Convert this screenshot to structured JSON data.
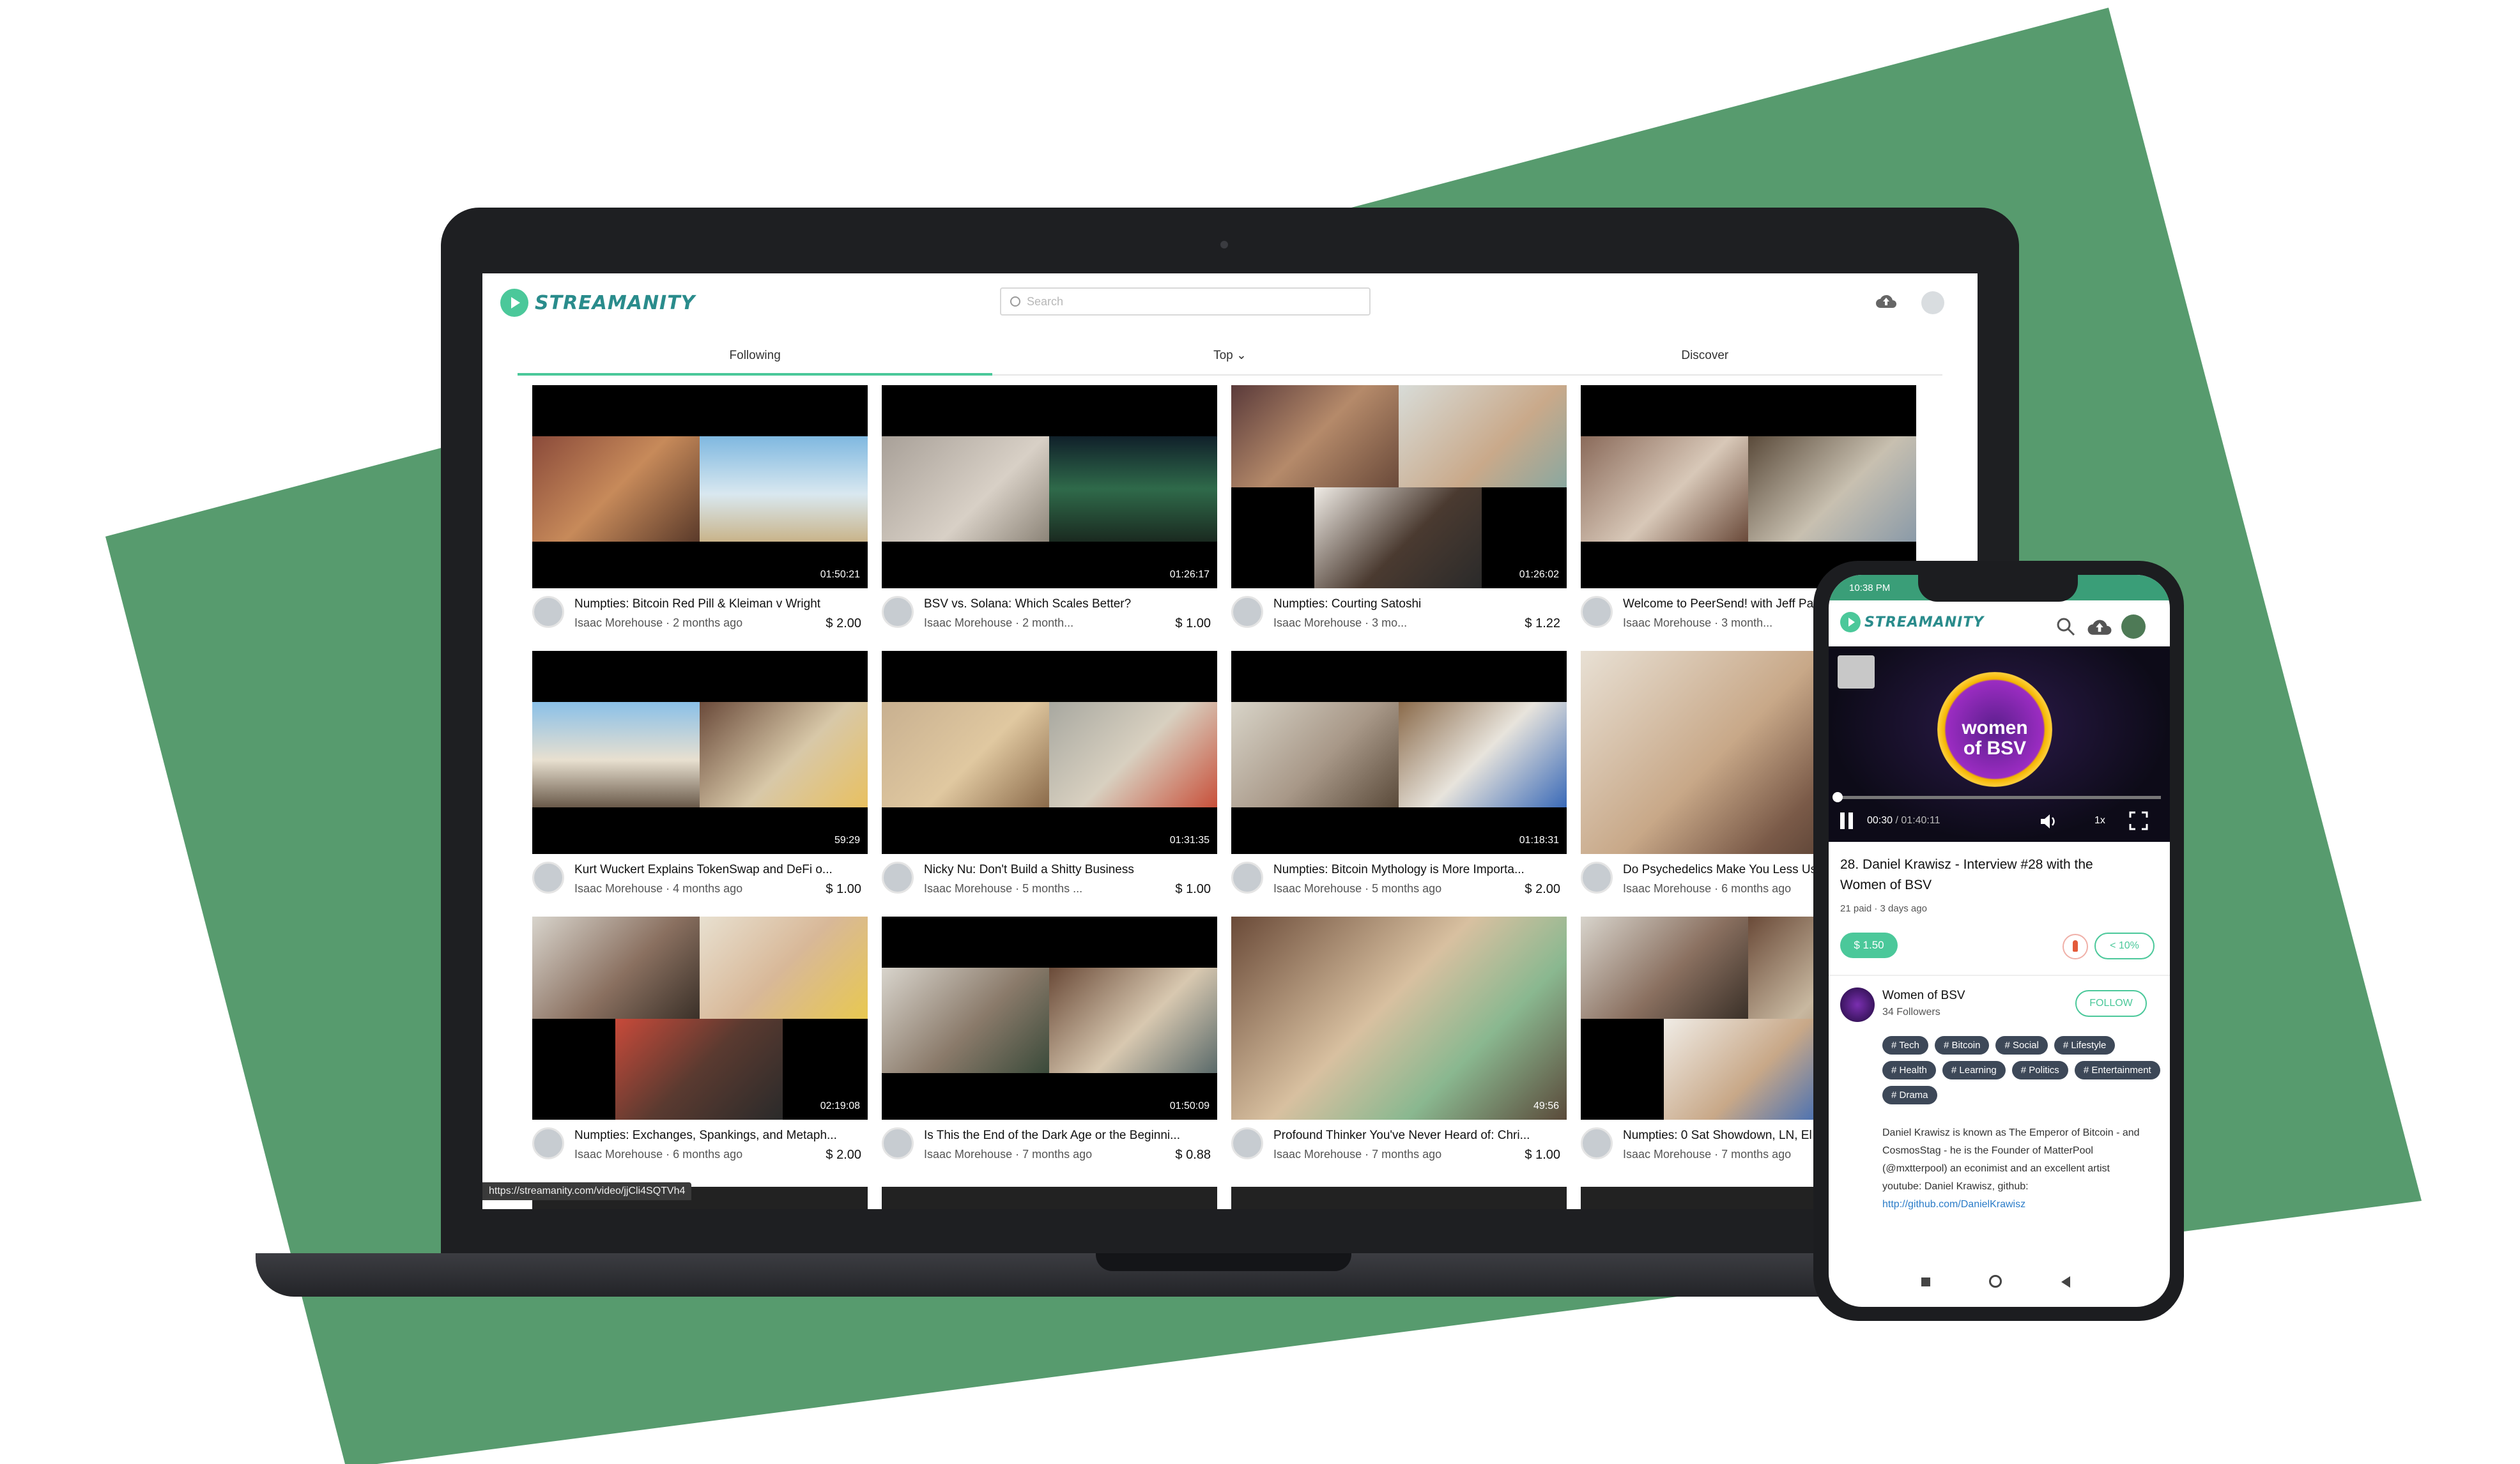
{
  "brand": {
    "name": "STREAMANITY",
    "accent_color": "#4bc89a",
    "background_shape_color": "#579b6e"
  },
  "desktop": {
    "search": {
      "placeholder": "Search"
    },
    "icons": {
      "upload": "cloud-upload-icon",
      "avatar": "user-avatar"
    },
    "tabs": [
      {
        "label": "Following",
        "active": true
      },
      {
        "label": "Top ⌄",
        "active": false
      },
      {
        "label": "Discover",
        "active": false
      }
    ],
    "videos": [
      {
        "title": "Numpties: Bitcoin Red Pill & Kleiman v Wright",
        "sub": "Isaac Morehouse · 2 months ago",
        "price": "$ 2.00",
        "duration": "01:50:21"
      },
      {
        "title": "BSV vs. Solana: Which Scales Better?",
        "sub": "Isaac Morehouse · 2 month...",
        "price": "$ 1.00",
        "duration": "01:26:17"
      },
      {
        "title": "Numpties: Courting Satoshi",
        "sub": "Isaac Morehouse · 3 mo...",
        "price": "$ 1.22",
        "duration": "01:26:02"
      },
      {
        "title": "Welcome to PeerSend! with Jeff Pa",
        "sub": "Isaac Morehouse · 3 month...",
        "price": "",
        "duration": ""
      },
      {
        "title": "Kurt Wuckert Explains TokenSwap and DeFi o...",
        "sub": "Isaac Morehouse · 4 months ago",
        "price": "$ 1.00",
        "duration": "59:29"
      },
      {
        "title": "Nicky Nu: Don't Build a Shitty Business",
        "sub": "Isaac Morehouse · 5 months ...",
        "price": "$ 1.00",
        "duration": "01:31:35"
      },
      {
        "title": "Numpties: Bitcoin Mythology is More Importa...",
        "sub": "Isaac Morehouse · 5 months ago",
        "price": "$ 2.00",
        "duration": "01:18:31"
      },
      {
        "title": "Do Psychedelics Make You Less Us",
        "sub": "Isaac Morehouse · 6 months ago",
        "price": "",
        "duration": ""
      },
      {
        "title": "Numpties: Exchanges, Spankings, and Metaph...",
        "sub": "Isaac Morehouse · 6 months ago",
        "price": "$ 2.00",
        "duration": "02:19:08"
      },
      {
        "title": "Is This the End of the Dark Age or the Beginni...",
        "sub": "Isaac Morehouse · 7 months ago",
        "price": "$ 0.88",
        "duration": "01:50:09"
      },
      {
        "title": "Profound Thinker You've Never Heard of: Chri...",
        "sub": "Isaac Morehouse · 7 months ago",
        "price": "$ 1.00",
        "duration": "49:56"
      },
      {
        "title": "Numpties: 0 Sat Showdown, LN, El S",
        "sub": "Isaac Morehouse · 7 months ago",
        "price": "",
        "duration": ""
      }
    ],
    "status_url": "https://streamanity.com/video/jjCli4SQTVh4"
  },
  "mobile": {
    "status_time": "10:38 PM",
    "player": {
      "badge_text_line1": "women",
      "badge_text_line2": "of BSV",
      "current_time": "00:30",
      "total_time": "/ 01:40:11",
      "speed": "1x",
      "progress": 0.005
    },
    "video_title": "28. Daniel Krawisz - Interview #28 with the Women of BSV",
    "video_meta": "21 paid · 3 days ago",
    "pay_label": "$ 1.50",
    "share_label": "< 10%",
    "channel": {
      "name": "Women of BSV",
      "followers": "34 Followers",
      "follow_label": "FOLLOW"
    },
    "tags": [
      "# Tech",
      "# Bitcoin",
      "# Social",
      "# Lifestyle",
      "# Health",
      "# Learning",
      "# Politics",
      "# Entertainment",
      "# Drama"
    ],
    "bio": "Daniel Krawisz is known as The Emperor of Bitcoin - and CosmosStag - he is the Founder of MatterPool (@mxtterpool) an econimist and an excellent artist",
    "bio_line2": "youtube: Daniel Krawisz, github:",
    "bio_link": "http://github.com/DanielKrawisz"
  }
}
